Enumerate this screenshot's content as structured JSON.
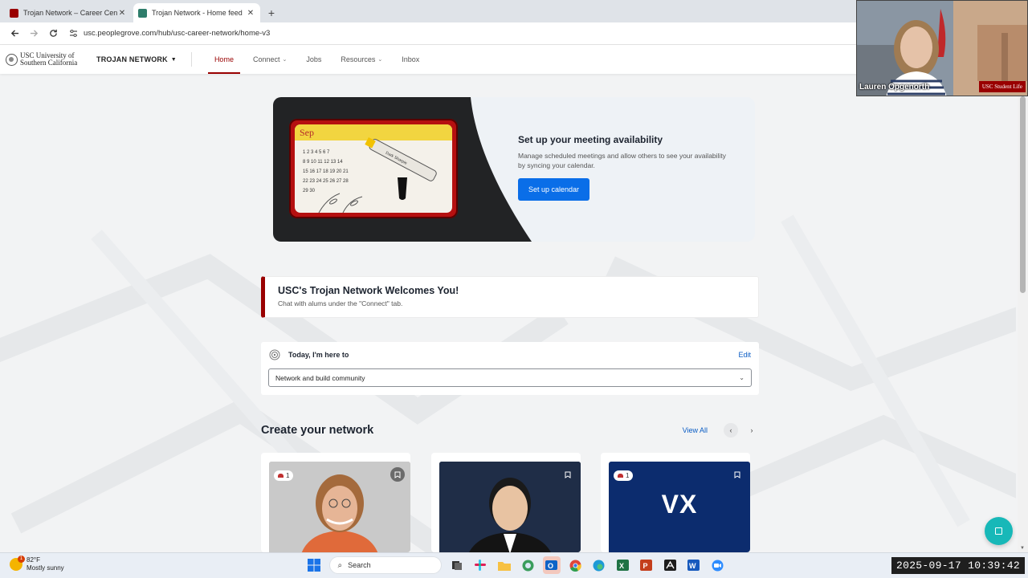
{
  "browser": {
    "tabs": [
      {
        "title": "Trojan Network – Career Center",
        "active": false,
        "favicon_color": "#990000"
      },
      {
        "title": "Trojan Network - Home feed",
        "active": true,
        "favicon_color": "#2e7d6b"
      }
    ],
    "url": "usc.peoplegrove.com/hub/usc-career-network/home-v3"
  },
  "site": {
    "logo_line1": "USC University of",
    "logo_line2": "Southern California",
    "brand": "TROJAN NETWORK",
    "nav": [
      "Home",
      "Connect",
      "Jobs",
      "Resources",
      "Inbox"
    ],
    "accent_color": "#990000"
  },
  "hero": {
    "title": "Set up your meeting availability",
    "description": "Manage scheduled meetings and allow others to see your availability by syncing your calendar.",
    "button": "Set up calendar"
  },
  "welcome": {
    "title": "USC's Trojan Network Welcomes You!",
    "subtitle": "Chat with alums under the \"Connect\" tab."
  },
  "intent": {
    "label": "Today, I'm here to",
    "edit": "Edit",
    "selected": "Network and build community"
  },
  "network": {
    "title": "Create your network",
    "view_all": "View All",
    "cards": [
      {
        "badge": "1",
        "kind": "photo-woman"
      },
      {
        "badge": "",
        "kind": "photo-man"
      },
      {
        "badge": "1",
        "initials": "VX",
        "kind": "initials"
      }
    ]
  },
  "video": {
    "name": "Lauren Opgenorth",
    "tag": "USC Student Life"
  },
  "taskbar": {
    "temp": "82°F",
    "condition": "Mostly sunny",
    "weather_alert": "1",
    "search_placeholder": "Search",
    "datetime": "2025-09-17  10:39:42"
  }
}
